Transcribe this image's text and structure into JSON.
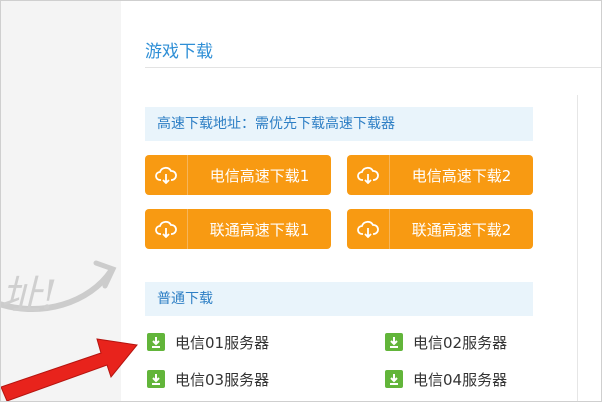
{
  "page": {
    "title": "游戏下载",
    "left_watermark": "址!"
  },
  "highspeed": {
    "header": "高速下载地址：需优先下载高速下载器",
    "buttons": [
      {
        "label": "电信高速下载1",
        "icon": "cloud-download-icon"
      },
      {
        "label": "电信高速下载2",
        "icon": "cloud-download-icon"
      },
      {
        "label": "联通高速下载1",
        "icon": "cloud-download-icon"
      },
      {
        "label": "联通高速下载2",
        "icon": "cloud-download-icon"
      }
    ]
  },
  "normal": {
    "header": "普通下载",
    "servers": [
      {
        "label": "电信01服务器",
        "icon": "download-arrow-icon"
      },
      {
        "label": "电信02服务器",
        "icon": "download-arrow-icon"
      },
      {
        "label": "电信03服务器",
        "icon": "download-arrow-icon"
      },
      {
        "label": "电信04服务器",
        "icon": "download-arrow-icon"
      }
    ]
  },
  "colors": {
    "accent_blue": "#2f8fd6",
    "button_orange": "#f89a12",
    "icon_green": "#62b53a",
    "arrow_red": "#e8231c"
  }
}
